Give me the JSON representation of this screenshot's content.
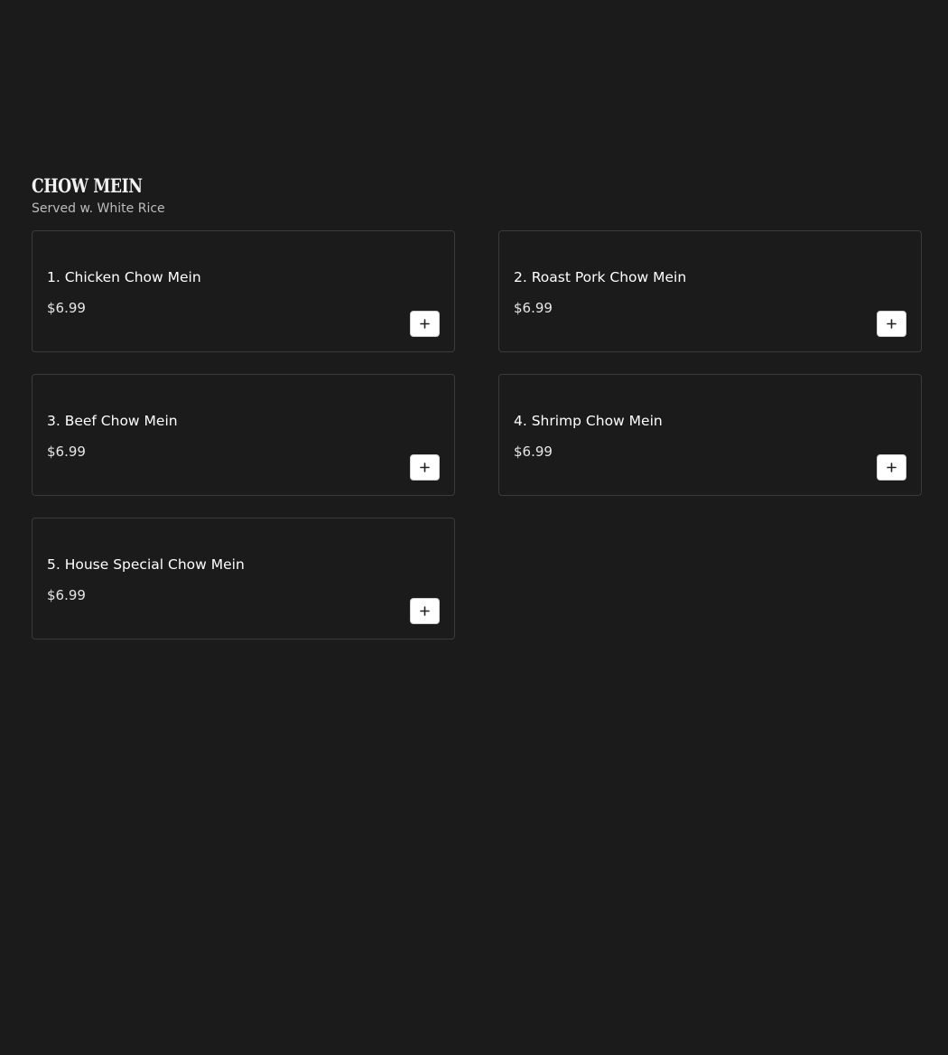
{
  "section": {
    "title": "CHOW MEIN",
    "subtitle": "Served w. White Rice"
  },
  "items": [
    {
      "name": "1. Chicken Chow Mein",
      "price": "$6.99"
    },
    {
      "name": "2. Roast Pork Chow Mein",
      "price": "$6.99"
    },
    {
      "name": "3. Beef Chow Mein",
      "price": "$6.99"
    },
    {
      "name": "4. Shrimp Chow Mein",
      "price": "$6.99"
    },
    {
      "name": "5. House Special Chow Mein",
      "price": "$6.99"
    }
  ],
  "icons": {
    "add": "plus-icon"
  },
  "colors": {
    "background": "#1b1b1b",
    "card_border": "#3b3b3b",
    "text": "#ffffff",
    "subtext": "#bdbdbd",
    "button": "#ffffff"
  }
}
